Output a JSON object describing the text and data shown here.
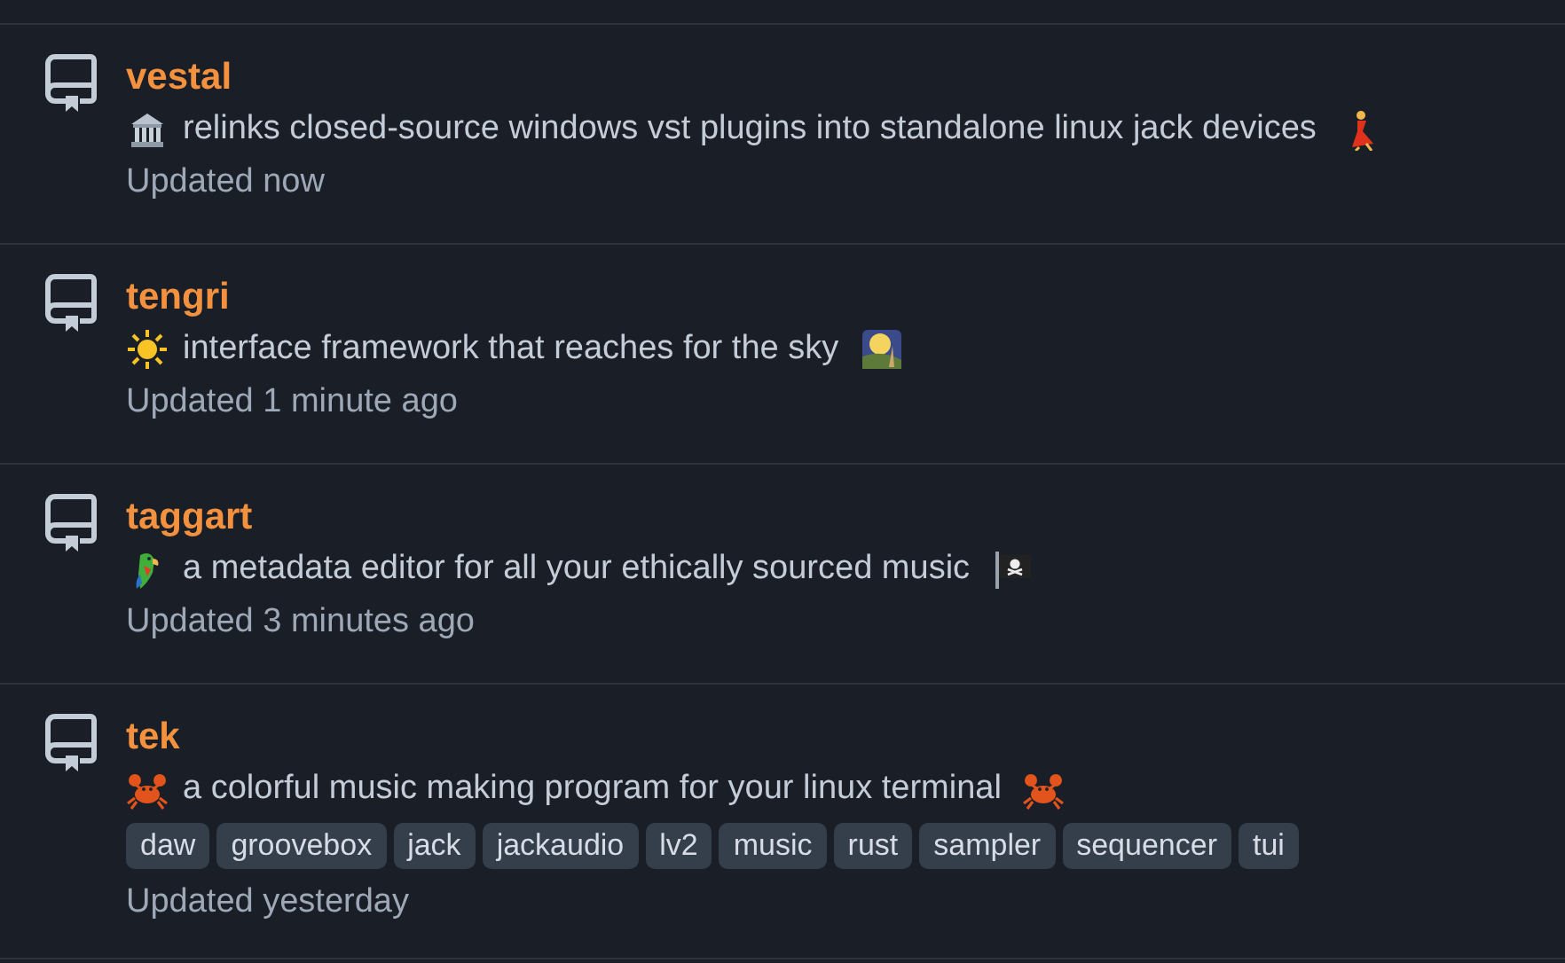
{
  "repositories": [
    {
      "name": "vestal",
      "description": "relinks closed-source windows vst plugins into standalone linux jack devices",
      "updated": "Updated now"
    },
    {
      "name": "tengri",
      "description": "interface framework that reaches for the sky",
      "updated": "Updated 1 minute ago"
    },
    {
      "name": "taggart",
      "description": "a metadata editor for all your ethically sourced music",
      "updated": "Updated 3 minutes ago"
    },
    {
      "name": "tek",
      "description": "a colorful music making program for your linux terminal",
      "topics": [
        "daw",
        "groovebox",
        "jack",
        "jackaudio",
        "lv2",
        "music",
        "rust",
        "sampler",
        "sequencer",
        "tui"
      ],
      "updated": "Updated yesterday"
    }
  ]
}
